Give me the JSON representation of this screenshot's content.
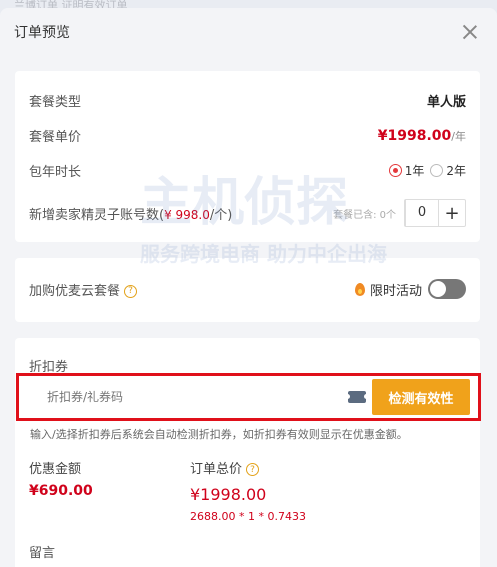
{
  "background": {
    "strip_text": "兰博订单  证明有效订单"
  },
  "modal": {
    "title": "订单预览",
    "plan": {
      "type_label": "套餐类型",
      "type_value": "单人版",
      "price_label": "套餐单价",
      "price_value": "¥1998.00",
      "price_unit": "/年",
      "duration_label": "包年时长",
      "duration_options": [
        "1年",
        "2年"
      ],
      "duration_selected": "1年",
      "subaccount_label": "新增卖家精灵子账号数(",
      "subaccount_price": "¥ 998.0",
      "subaccount_unit": "/个)",
      "subaccount_remaining": "套餐已含: 0个",
      "subaccount_qty": "0",
      "plus": "+"
    },
    "addon": {
      "label": "加购优麦云套餐",
      "help": "?",
      "promo_label": "限时活动"
    },
    "coupon": {
      "section_label": "折扣券",
      "input_placeholder": "折扣券/礼券码",
      "check_button": "检测有效性",
      "hint": "输入/选择折扣券后系统会自动检测折扣券，如折扣券有效则显示在优惠金额。",
      "discount_label": "优惠金额",
      "discount_value": "¥690.00",
      "total_label": "订单总价",
      "total_help": "?",
      "total_value": "¥1998.00",
      "formula": "2688.00 * 1 * 0.7433",
      "remark_label": "留言"
    }
  },
  "watermark": {
    "logo_text": "主机侦探",
    "slogan": "服务跨境电商 助力中企出海"
  },
  "colors": {
    "accent_red": "#d0021b",
    "button_orange": "#f0a21b",
    "highlight_border": "#e0101a"
  }
}
